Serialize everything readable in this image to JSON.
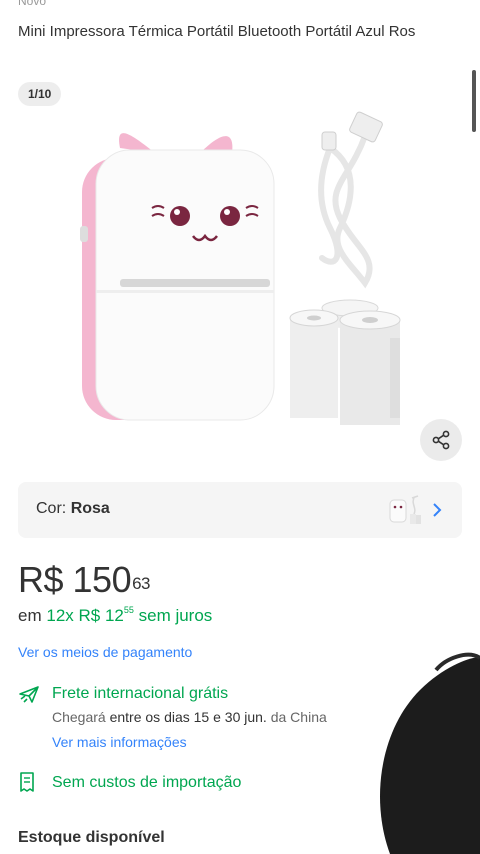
{
  "product": {
    "condition": "Novo",
    "title": "Mini Impressora Térmica Portátil Bluetooth Portátil Azul Ros",
    "image_counter": "1/10"
  },
  "variant": {
    "label": "Cor:",
    "value": "Rosa"
  },
  "price": {
    "main": "R$ 150",
    "cents": "63",
    "installments_prefix": "em",
    "installments_amount": "12x R$ 12",
    "installments_cents": "55",
    "installments_suffix": "sem juros",
    "payment_link": "Ver os meios de pagamento"
  },
  "shipping": {
    "title": "Frete internacional grátis",
    "eta_prefix": "Chegará",
    "eta_dates": "entre os dias 15 e 30 jun.",
    "eta_suffix": "da China",
    "more_link": "Ver mais informações"
  },
  "import": {
    "text": "Sem custos de importação"
  },
  "stock": {
    "title": "Estoque disponível"
  },
  "colors": {
    "green": "#00a650",
    "blue_link": "#3483fa",
    "printer_pink": "#f4b6cf"
  }
}
